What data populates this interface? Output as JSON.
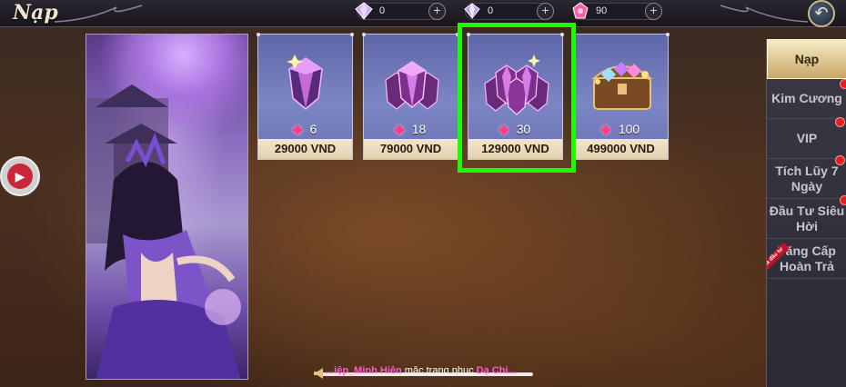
{
  "header": {
    "title": "Nạp",
    "currencies": [
      {
        "icon": "diamond-icon",
        "value": "0"
      },
      {
        "icon": "bound-diamond-icon",
        "value": "0"
      },
      {
        "icon": "coin-icon",
        "value": "90"
      }
    ],
    "back_icon": "back-arrow-icon"
  },
  "packages": [
    {
      "gems": "6",
      "price": "29000 VND",
      "icon": "single-gem-icon"
    },
    {
      "gems": "18",
      "price": "79000 VND",
      "icon": "three-gems-icon"
    },
    {
      "gems": "30",
      "price": "129000 VND",
      "icon": "gem-pile-icon",
      "selected": true
    },
    {
      "gems": "100",
      "price": "499000 VND",
      "icon": "treasure-chest-icon"
    }
  ],
  "sidebar": {
    "tabs": [
      {
        "label": "Nạp",
        "active": true,
        "badge": false
      },
      {
        "label": "Kim Cương",
        "badge": true
      },
      {
        "label": "VIP",
        "badge": true
      },
      {
        "label": "Tích Lũy 7 Ngày",
        "badge": true
      },
      {
        "label": "Đầu Tư Siêu Hời",
        "badge": false
      },
      {
        "label": "Tăng Cấp Hoàn Trả",
        "badge": false,
        "ribbon": "Mua đầu tư"
      }
    ]
  },
  "marquee": {
    "name": "...iệp_Minh Hiên",
    "text": " mặc trang phục ",
    "item": "Dạ Chi..."
  },
  "colors": {
    "selection_frame": "#1aff00",
    "price_bg": "#f3e6cf",
    "card_bg": "#6a72b4",
    "active_tab": "#e6d09a"
  }
}
